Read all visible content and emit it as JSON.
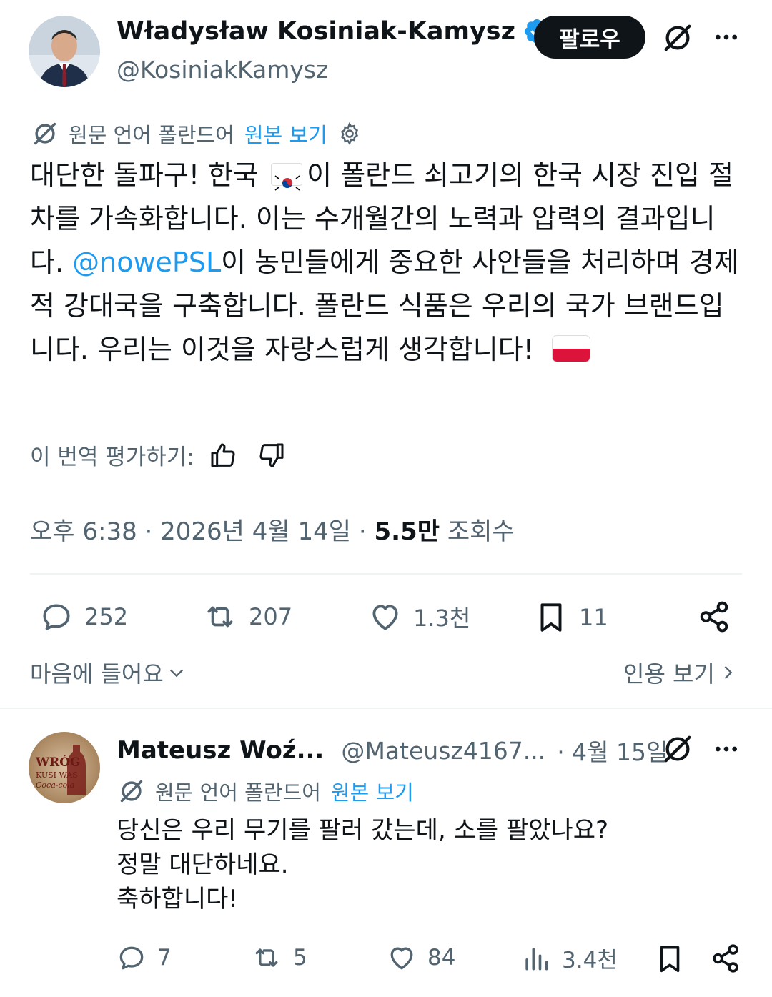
{
  "author": {
    "name": "Władysław Kosiniak-Kamysz",
    "handle": "@KosiniakKamysz",
    "follow_label": "팔로우"
  },
  "translation": {
    "source_label": "원문 언어 폴란드어",
    "show_original": "원본 보기"
  },
  "tweet": {
    "text_1": "대단한 돌파구! 한국",
    "text_2": "이 폴란드 쇠고기의 한국 시장 진입 절차를 가속화합니다. 이는 수개월간의 노력과 압력의 결과입니다.",
    "mention": "@nowePSL",
    "text_3": "이 농민들에게 중요한 사안들을 처리하며 경제적 강대국을 구축합니다. 폴란드 식품은 우리의 국가 브랜드입니다. 우리는 이것을 자랑스럽게 생각합니다!",
    "rate_label": "이 번역 평가하기:",
    "time": "오후 6:38",
    "date": "2026년 4월 14일",
    "views_count": "5.5만",
    "views_label": "조회수",
    "stats": {
      "replies": "252",
      "reposts": "207",
      "likes": "1.3천",
      "bookmarks": "11"
    },
    "likes_link": "마음에 들어요",
    "quotes_link": "인용 보기"
  },
  "reply": {
    "name": "Mateusz Woź...",
    "handle": "@Mateusz4167...",
    "date": "· 4월 15일",
    "avatar_text_1": "WRÓG",
    "avatar_text_2": "KUSI WAS",
    "avatar_text_3": "Coca-cola",
    "line_1": "당신은 우리 무기를 팔러 갔는데, 소를 팔았나요?",
    "line_2": "정말 대단하네요.",
    "line_3": "축하합니다!",
    "stats": {
      "replies": "7",
      "reposts": "5",
      "likes": "84",
      "views": "3.4천"
    }
  },
  "colors": {
    "accent": "#1d9bf0",
    "text": "#0f1419",
    "muted": "#536471",
    "verified": "#1d9bf0"
  }
}
